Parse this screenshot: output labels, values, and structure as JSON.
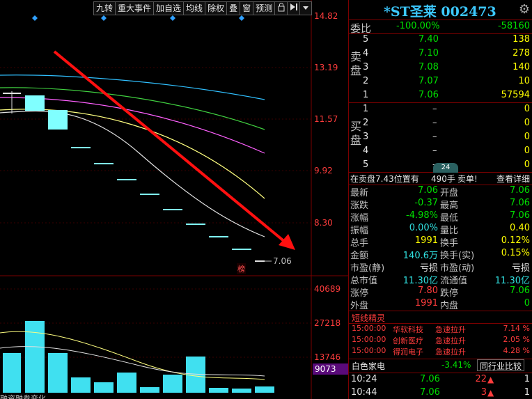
{
  "toolbar": {
    "buttons": [
      "九转",
      "重大事件",
      "加自选",
      "均线",
      "除权",
      "叠",
      "窗",
      "预测"
    ]
  },
  "price_axis": [
    "14.82",
    "13.19",
    "11.57",
    "9.92",
    "8.30"
  ],
  "volume_axis": [
    "40689",
    "27218",
    "13746"
  ],
  "volume_current": "9073",
  "last_price_label": "7.06",
  "bang_label": "榜",
  "bottom_tab": "融资融券变化",
  "stock": {
    "title": "*ST圣莱 002473"
  },
  "weibi": {
    "label": "委比",
    "pct": "-100.00%",
    "value": "-58160"
  },
  "sell_side_label": "卖盘",
  "buy_side_label": "买盘",
  "sell_orders": [
    {
      "level": "5",
      "price": "7.40",
      "volume": "138"
    },
    {
      "level": "4",
      "price": "7.10",
      "volume": "278"
    },
    {
      "level": "3",
      "price": "7.08",
      "volume": "140"
    },
    {
      "level": "2",
      "price": "7.07",
      "volume": "10"
    },
    {
      "level": "1",
      "price": "7.06",
      "volume": "57594"
    }
  ],
  "buy_orders": [
    {
      "level": "1",
      "price": "–",
      "volume": "0"
    },
    {
      "level": "2",
      "price": "–",
      "volume": "0"
    },
    {
      "level": "3",
      "price": "–",
      "volume": "0"
    },
    {
      "level": "4",
      "price": "–",
      "volume": "0"
    },
    {
      "level": "5",
      "price": "–",
      "volume": "0"
    }
  ],
  "position_note": {
    "prefix": "在卖盘7.43位置有",
    "qty": "490手",
    "tag": "卖单!",
    "detail": "查看详细",
    "tab": "24"
  },
  "quote": [
    {
      "l1": "最新",
      "v1": "7.06",
      "l2": "开盘",
      "v2": "7.06"
    },
    {
      "l1": "涨跌",
      "v1": "-0.37",
      "l2": "最高",
      "v2": "7.06"
    },
    {
      "l1": "涨幅",
      "v1": "-4.98%",
      "l2": "最低",
      "v2": "7.06"
    },
    {
      "l1": "振幅",
      "v1": "0.00%",
      "l2": "量比",
      "v2": "0.40"
    },
    {
      "l1": "总手",
      "v1": "1991",
      "l2": "换手",
      "v2": "0.12%"
    },
    {
      "l1": "金额",
      "v1": "140.6万",
      "l2": "换手(实)",
      "v2": "0.15%"
    },
    {
      "l1": "市盈(静)",
      "v1": "亏损",
      "l2": "市盈(动)",
      "v2": "亏损"
    },
    {
      "l1": "总市值",
      "v1": "11.30亿",
      "l2": "流通值",
      "v2": "11.30亿"
    },
    {
      "l1": "涨停",
      "v1": "7.80",
      "l2": "跌停",
      "v2": "7.06"
    },
    {
      "l1": "外盘",
      "v1": "1991",
      "l2": "内盘",
      "v2": "0"
    }
  ],
  "shortline": {
    "title": "短线精灵",
    "items": [
      {
        "time": "15:00:00",
        "name": "华软科技",
        "event": "急速拉升",
        "pct": "7.14 %"
      },
      {
        "time": "15:00:00",
        "name": "创新医疗",
        "event": "急速拉升",
        "pct": "2.05 %"
      },
      {
        "time": "15:00:00",
        "name": "得润电子",
        "event": "急速拉升",
        "pct": "4.28 %"
      }
    ]
  },
  "industry": {
    "name": "白色家电",
    "pct": "-3.41%",
    "button": "同行业比较"
  },
  "ticks": [
    {
      "time": "10:24",
      "price": "7.06",
      "vol": "22",
      "count": "1"
    },
    {
      "time": "10:44",
      "price": "7.06",
      "vol": "3",
      "count": "1"
    }
  ],
  "colors": {
    "up": "#ff3c3c",
    "down": "#00e000",
    "cyan_candle": "#80ffff",
    "ma_cyan": "#30c0ff",
    "ma_green": "#40d040",
    "ma_magenta": "#ff60ff",
    "ma_yellow": "#ffff80",
    "arrow": "#ff1010",
    "panel_border": "#7a0000",
    "title": "#3cc8ff"
  }
}
